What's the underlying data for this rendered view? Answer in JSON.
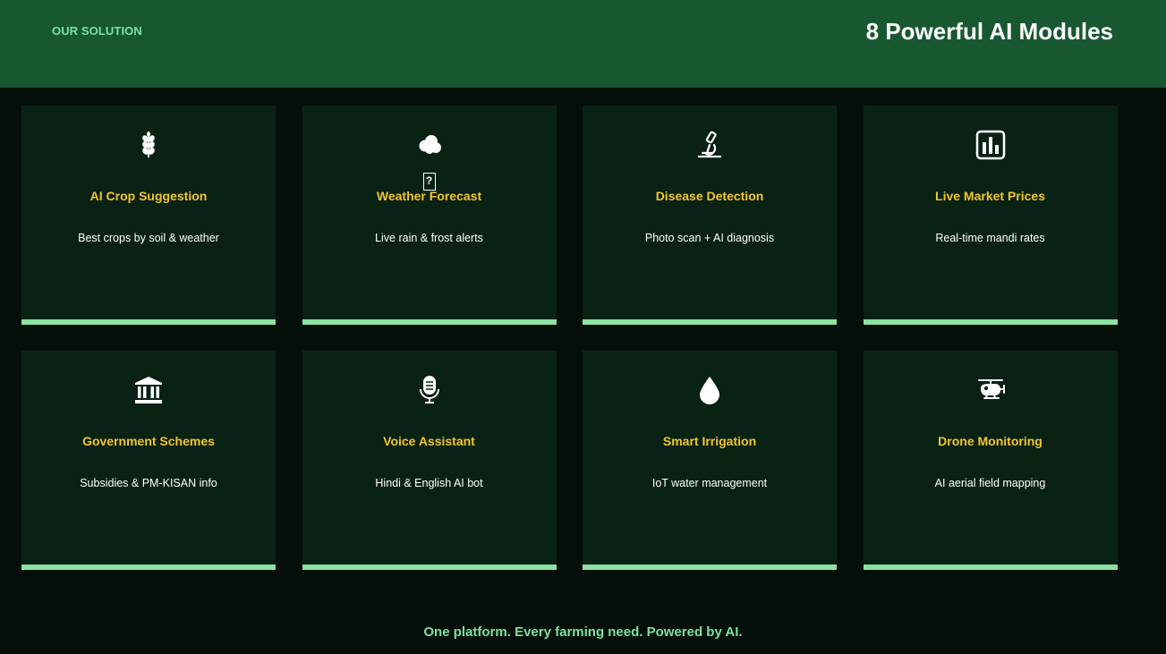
{
  "header": {
    "eyebrow": "OUR SOLUTION",
    "title": "8 Powerful AI Modules"
  },
  "modules": [
    {
      "icon": "wheat-icon",
      "title": "AI Crop Suggestion",
      "desc": "Best crops by soil & weather"
    },
    {
      "icon": "cloud-icon",
      "title": "Weather Forecast",
      "desc": "Live rain & frost alerts"
    },
    {
      "icon": "microscope-icon",
      "title": "Disease Detection",
      "desc": "Photo scan + AI diagnosis"
    },
    {
      "icon": "bar-chart-icon",
      "title": "Live Market Prices",
      "desc": "Real-time mandi rates"
    },
    {
      "icon": "bank-icon",
      "title": "Government Schemes",
      "desc": "Subsidies & PM-KISAN info"
    },
    {
      "icon": "microphone-icon",
      "title": "Voice Assistant",
      "desc": "Hindi & English AI bot"
    },
    {
      "icon": "water-drop-icon",
      "title": "Smart Irrigation",
      "desc": "IoT water management"
    },
    {
      "icon": "helicopter-icon",
      "title": "Drone Monitoring",
      "desc": "AI aerial field mapping"
    }
  ],
  "footer": {
    "tagline": "One platform. Every farming need. Powered by AI."
  },
  "colors": {
    "background": "#050f09",
    "header": "#185831",
    "card": "#0a2214",
    "accent_green": "#8ae2a3",
    "title_yellow": "#f3c62c"
  }
}
